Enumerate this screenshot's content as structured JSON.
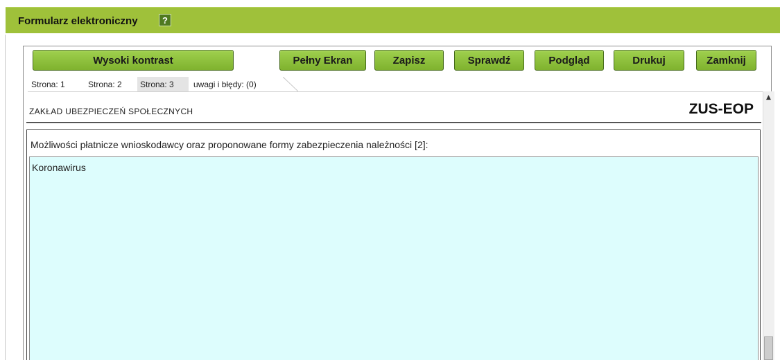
{
  "header": {
    "title": "Formularz elektroniczny",
    "help_icon": "?"
  },
  "toolbar": {
    "high_contrast": "Wysoki kontrast",
    "fullscreen": "Pełny Ekran",
    "save": "Zapisz",
    "check": "Sprawdź",
    "preview": "Podgląd",
    "print": "Drukuj",
    "close": "Zamknij"
  },
  "tabs": [
    {
      "label": "Strona: 1",
      "active": false
    },
    {
      "label": "Strona: 2",
      "active": false
    },
    {
      "label": "Strona: 3",
      "active": true
    },
    {
      "label": "uwagi i błędy: (0)",
      "active": false
    }
  ],
  "form": {
    "agency": "ZAKŁAD UBEZPIECZEŃ SPOŁECZNYCH",
    "code": "ZUS-EOP",
    "field_label": "Możliwości płatnicze wnioskodawcy oraz proponowane formy zabezpieczenia należności [2]:",
    "field_value": "Koronawirus"
  },
  "scrollbar": {
    "up_arrow": "▲"
  },
  "colors": {
    "header_bg": "#9fc13a",
    "button_bg": "#8cc43c",
    "textarea_bg": "#ddfdfd"
  }
}
